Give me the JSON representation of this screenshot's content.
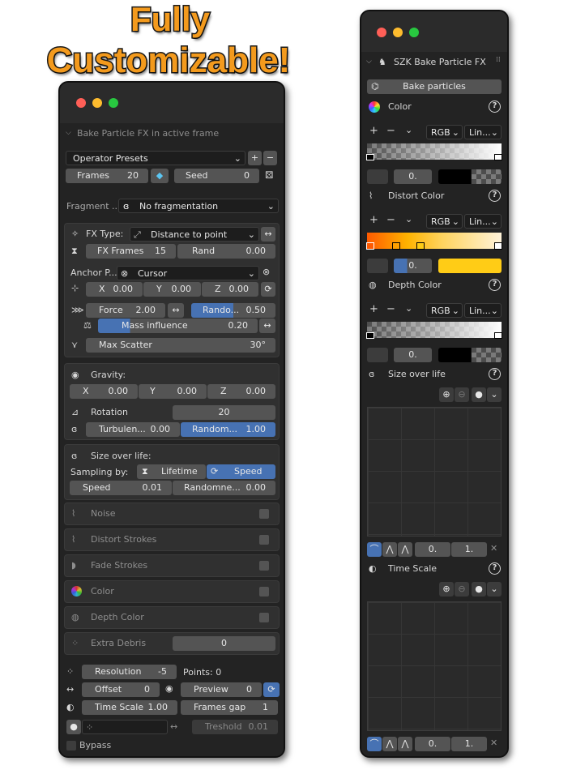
{
  "headline": {
    "line1": "Fully",
    "line2": "Customizable!"
  },
  "colors": {
    "accent": "#4772b3",
    "headline": "#f39a1d",
    "panel": "#232323",
    "field": "#545454",
    "yellow": "#ffcc16"
  },
  "left": {
    "header": "Bake Particle FX in active frame",
    "presets": "Operator Presets",
    "frames": {
      "label": "Frames",
      "value": "20"
    },
    "seed": {
      "label": "Seed",
      "value": "0"
    },
    "fragment": {
      "label": "Fragment ...",
      "value": "No fragmentation"
    },
    "fx": {
      "type_label": "FX Type:",
      "type_value": "Distance to point",
      "frames_label": "FX Frames",
      "frames_value": "15",
      "rand_label": "Rand",
      "rand_value": "0.00",
      "anchor_label": "Anchor P...",
      "anchor_value": "Cursor",
      "x_label": "X",
      "x_value": "0.00",
      "y_label": "Y",
      "y_value": "0.00",
      "z_label": "Z",
      "z_value": "0.00",
      "force_label": "Force",
      "force_value": "2.00",
      "random_label": "Rando...",
      "random_value": "0.50",
      "mass_label": "Mass influence",
      "mass_value": "0.20",
      "scatter_label": "Max Scatter",
      "scatter_value": "30°"
    },
    "gravity": {
      "label": "Gravity:",
      "x_label": "X",
      "x_value": "0.00",
      "y_label": "Y",
      "y_value": "0.00",
      "z_label": "Z",
      "z_value": "0.00",
      "rotation_label": "Rotation",
      "rotation_value": "20",
      "turb_label": "Turbulen...",
      "turb_value": "0.00",
      "random_label": "Random...",
      "random_value": "1.00"
    },
    "size": {
      "label": "Size over life:",
      "sampling_label": "Sampling by:",
      "lifetime": "Lifetime",
      "speed_tab": "Speed",
      "speed_label": "Speed",
      "speed_value": "0.01",
      "randomness_label": "Randomne...",
      "randomness_value": "0.00"
    },
    "toggles": [
      "Noise",
      "Distort Strokes",
      "Fade Strokes",
      "Color",
      "Depth Color"
    ],
    "extra": {
      "label": "Extra Debris",
      "value": "0"
    },
    "resolution": {
      "label": "Resolution",
      "value": "-5",
      "points": "Points: 0"
    },
    "offset": {
      "label": "Offset",
      "value": "0"
    },
    "preview": {
      "label": "Preview",
      "value": "0"
    },
    "timescale": {
      "label": "Time Scale",
      "value": "1.00"
    },
    "framesgap": {
      "label": "Frames gap",
      "value": "1"
    },
    "threshold": {
      "label": "Treshold",
      "value": "0.01"
    },
    "bypass": "Bypass"
  },
  "right": {
    "title": "SZK Bake Particle FX",
    "bake_button": "Bake particles",
    "color": {
      "label": "Color",
      "mode": "RGB",
      "interp": "Lin...",
      "pos": "0."
    },
    "distort": {
      "label": "Distort Color",
      "mode": "RGB",
      "interp": "Lin...",
      "pos": "0."
    },
    "depth": {
      "label": "Depth Color",
      "mode": "RGB",
      "interp": "Lin...",
      "pos": "0."
    },
    "size": {
      "label": "Size over life",
      "v1": "0.",
      "v2": "1."
    },
    "timescale": {
      "label": "Time Scale",
      "v1": "0.",
      "v2": "1."
    }
  }
}
